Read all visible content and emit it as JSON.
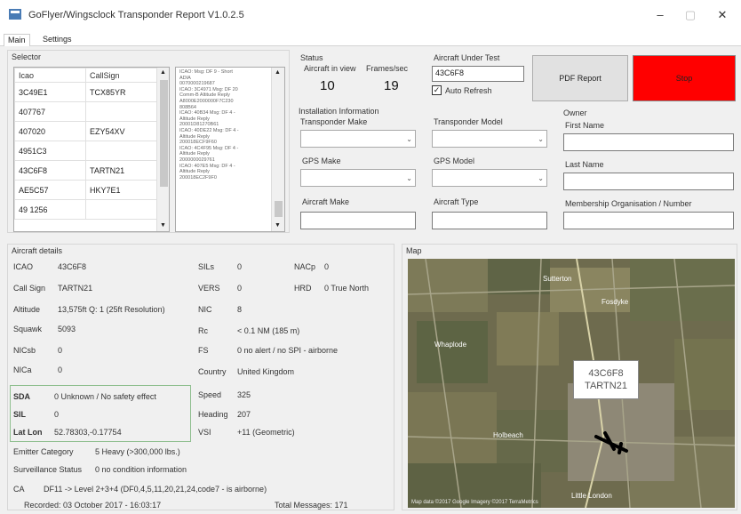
{
  "window": {
    "title": "GoFlyer/Wingsclock Transponder Report V1.0.2.5",
    "minimize": "–",
    "maximize": "▢",
    "close": "✕"
  },
  "tabs": [
    {
      "label": "Main"
    },
    {
      "label": "Settings"
    }
  ],
  "selector": {
    "title": "Selector",
    "columns": [
      "Icao",
      "CallSign"
    ],
    "rows": [
      {
        "icao": "3C49E1",
        "callsign": "TCX85YR"
      },
      {
        "icao": "407767",
        "callsign": ""
      },
      {
        "icao": "407020",
        "callsign": "EZY54XV"
      },
      {
        "icao": "4951C3",
        "callsign": ""
      },
      {
        "icao": "43C6F8",
        "callsign": "TARTN21"
      },
      {
        "icao": "AE5C57",
        "callsign": "HKY7E1"
      },
      {
        "icao": "49 1256",
        "callsign": ""
      }
    ],
    "log": [
      "ICAO: Msg: DF 9 - Short",
      "ADIA",
      "0070000219687",
      "ICAO: 3C4971 Msg: DF 20",
      "Comm-B Altitude Reply",
      "A8000E2000000F7C230",
      "808B64",
      "ICAO: 40B34 Msg: DF 4 -",
      "Altitude Reply",
      "20001D81270B61",
      "ICAO: 40DE22 Msg: DF 4 -",
      "Altitude Reply",
      "200018ECF9F60",
      "ICAO: 4C4F95 Msg: DF 4 -",
      "Altitude Reply",
      "2000000029761",
      "ICAO: 407E5 Msg: DF 4 -",
      "Altitude Reply",
      "200018EC2F9F0"
    ]
  },
  "status": {
    "title": "Status",
    "aircraft_in_view_label": "Aircraft in view",
    "frames_sec_label": "Frames/sec",
    "aircraft_in_view": "10",
    "frames_sec": "19"
  },
  "aircraft_under_test": {
    "title": "Aircraft Under Test",
    "value": "43C6F8",
    "auto_refresh_label": "Auto Refresh",
    "auto_refresh": true
  },
  "buttons": {
    "pdf_report": "PDF Report",
    "stop": "Stop",
    "stop_color": "#ff0000"
  },
  "installation": {
    "title": "Installation Information",
    "transponder_make": "Transponder Make",
    "transponder_model": "Transponder Model",
    "gps_make": "GPS Make",
    "gps_model": "GPS Model",
    "aircraft_make": "Aircraft Make",
    "aircraft_type": "Aircraft Type"
  },
  "owner": {
    "title": "Owner",
    "first_name": "First Name",
    "last_name": "Last Name",
    "membership": "Membership Organisation / Number"
  },
  "details": {
    "title": "Aircraft details",
    "icao_k": "ICAO",
    "icao_v": "43C6F8",
    "callsign_k": "Call Sign",
    "callsign_v": "TARTN21",
    "altitude_k": "Altitude",
    "altitude_v": "13,575ft Q: 1 (25ft Resolution)",
    "squawk_k": "Squawk",
    "squawk_v": "5093",
    "nicsb_k": "NICsb",
    "nicsb_v": "0",
    "nica_k": "NICa",
    "nica_v": "0",
    "sda_k": "SDA",
    "sda_v": "0 Unknown / No safety effect",
    "sil_k": "SIL",
    "sil_v": "0",
    "latlon_k": "Lat Lon",
    "latlon_v": "52.78303,-0.17754",
    "sils_k": "SILs",
    "sils_v": "0",
    "vers_k": "VERS",
    "vers_v": "0",
    "nic_k": "NIC",
    "nic_v": "8",
    "rc_k": "Rc",
    "rc_v": "< 0.1 NM (185 m)",
    "fs_k": "FS",
    "fs_v": "0 no alert / no SPI - airborne",
    "country_k": "Country",
    "country_v": "United Kingdom",
    "speed_k": "Speed",
    "speed_v": "325",
    "heading_k": "Heading",
    "heading_v": "207",
    "vsi_k": "VSI",
    "vsi_v": "+11 (Geometric)",
    "nacp_k": "NACp",
    "nacp_v": "0",
    "hrd_k": "HRD",
    "hrd_v": "0 True North",
    "emitter_k": "Emitter Category",
    "emitter_v": "5 Heavy (>300,000 lbs.)",
    "surveillance_k": "Surveillance Status",
    "surveillance_v": "0 no condition information",
    "ca_k": "CA",
    "ca_v": "DF11 -> Level 2+3+4 (DF0,4,5,11,20,21,24,code7 - is airborne)",
    "recorded": "Recorded: 03 October 2017 - 16:03:17",
    "total_messages": "Total Messages: 171"
  },
  "map": {
    "title": "Map",
    "label_icao": "43C6F8",
    "label_callsign": "TARTN21",
    "places": [
      "Sutterton",
      "Fosdyke",
      "Whaplode",
      "Holbeach",
      "Little London"
    ],
    "attribution": "Map data ©2017 Google Imagery ©2017 TerraMetrics"
  }
}
